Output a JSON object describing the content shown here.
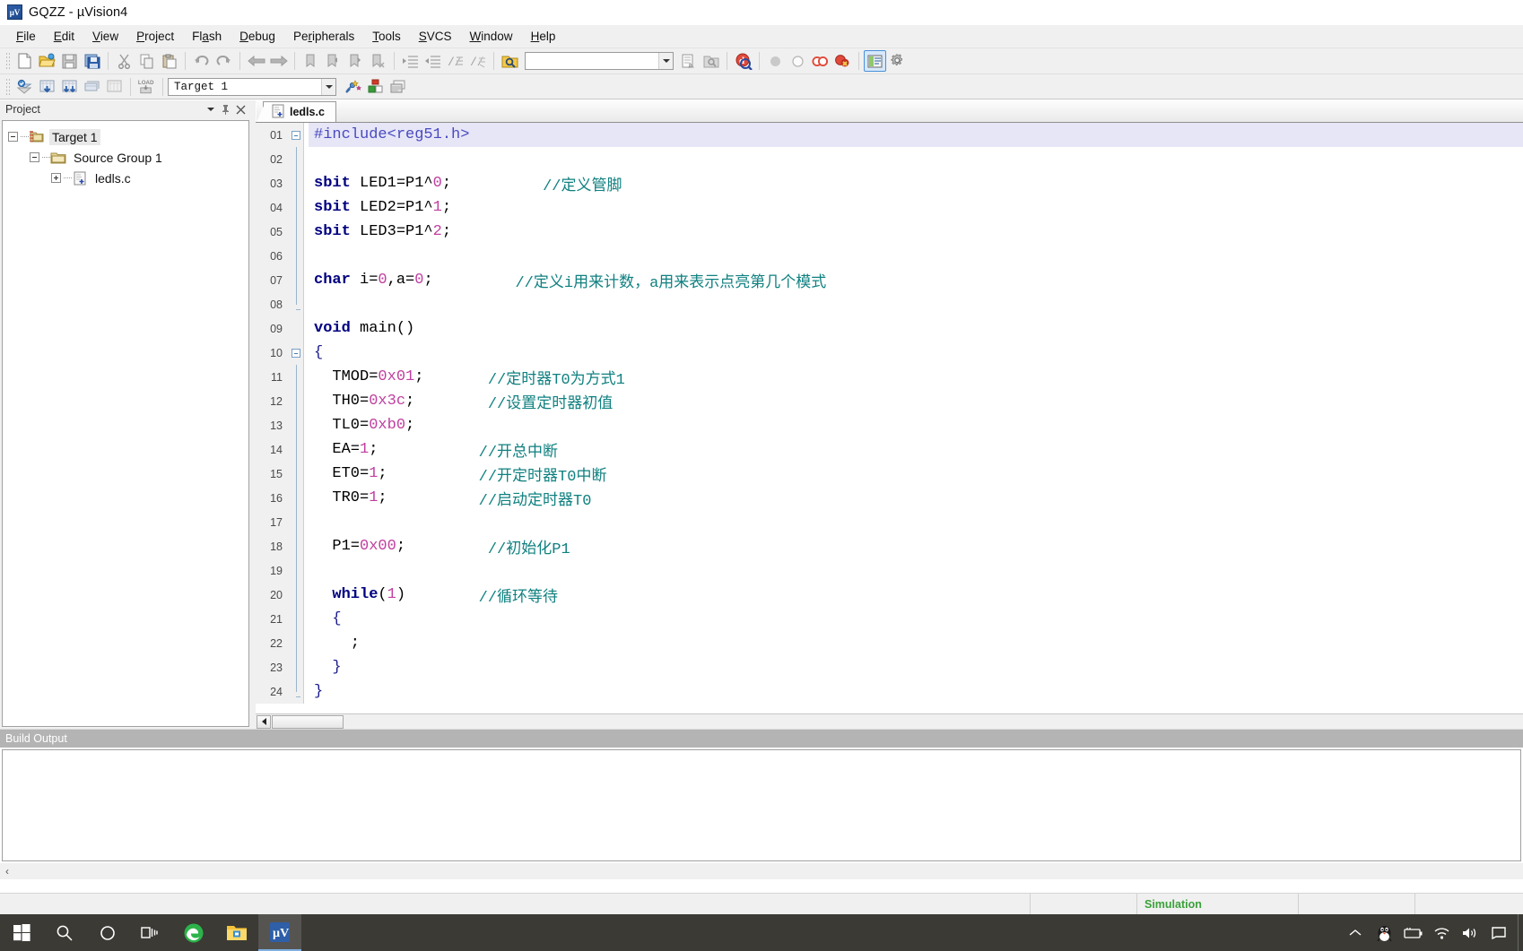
{
  "window": {
    "title": "GQZZ  -  µVision4",
    "app_icon": "uvision-logo-icon"
  },
  "menubar": {
    "items": [
      {
        "label": "File",
        "mnemonic": "F"
      },
      {
        "label": "Edit",
        "mnemonic": "E"
      },
      {
        "label": "View",
        "mnemonic": "V"
      },
      {
        "label": "Project",
        "mnemonic": "P"
      },
      {
        "label": "Flash",
        "mnemonic": "a"
      },
      {
        "label": "Debug",
        "mnemonic": "D"
      },
      {
        "label": "Peripherals",
        "mnemonic": "r"
      },
      {
        "label": "Tools",
        "mnemonic": "T"
      },
      {
        "label": "SVCS",
        "mnemonic": "S"
      },
      {
        "label": "Window",
        "mnemonic": "W"
      },
      {
        "label": "Help",
        "mnemonic": "H"
      }
    ]
  },
  "toolbar_main": {
    "buttons": [
      {
        "name": "new-file-icon",
        "tip": "New"
      },
      {
        "name": "open-file-icon",
        "tip": "Open"
      },
      {
        "name": "save-icon",
        "tip": "Save"
      },
      {
        "name": "save-all-icon",
        "tip": "Save All"
      },
      {
        "name": "cut-icon",
        "tip": "Cut"
      },
      {
        "name": "copy-icon",
        "tip": "Copy"
      },
      {
        "name": "paste-icon",
        "tip": "Paste"
      },
      {
        "name": "undo-icon",
        "tip": "Undo"
      },
      {
        "name": "redo-icon",
        "tip": "Redo"
      },
      {
        "name": "navigate-back-icon",
        "tip": "Back"
      },
      {
        "name": "navigate-forward-icon",
        "tip": "Forward"
      },
      {
        "name": "bookmark-toggle-icon",
        "tip": "Insert/Remove Bookmark"
      },
      {
        "name": "bookmark-prev-icon",
        "tip": "Previous Bookmark"
      },
      {
        "name": "bookmark-next-icon",
        "tip": "Next Bookmark"
      },
      {
        "name": "bookmark-clear-icon",
        "tip": "Clear All Bookmarks"
      },
      {
        "name": "indent-increase-icon",
        "tip": "Indent"
      },
      {
        "name": "indent-decrease-icon",
        "tip": "Outdent"
      },
      {
        "name": "comment-icon",
        "tip": "Comment"
      },
      {
        "name": "uncomment-icon",
        "tip": "Uncomment"
      },
      {
        "name": "find-in-files-icon",
        "tip": "Find in Files"
      }
    ],
    "search_value": "",
    "search_placeholder": "",
    "right_buttons": [
      {
        "name": "bookmark-list-icon",
        "tip": "Bookmarks"
      },
      {
        "name": "find-next-icon",
        "tip": "Find Next"
      },
      {
        "name": "start-debug-icon",
        "tip": "Start/Stop Debug Session"
      },
      {
        "name": "breakpoint-filled-icon",
        "tip": "Insert/Remove Breakpoint"
      },
      {
        "name": "breakpoint-empty-icon",
        "tip": "Enable/Disable Breakpoint"
      },
      {
        "name": "breakpoints-disable-all-icon",
        "tip": "Disable All Breakpoints"
      },
      {
        "name": "breakpoints-kill-all-icon",
        "tip": "Kill All Breakpoints"
      },
      {
        "name": "project-window-icon",
        "tip": "Project Window",
        "active": true
      },
      {
        "name": "configure-icon",
        "tip": "Configuration Wizard"
      }
    ]
  },
  "toolbar_build": {
    "buttons": [
      {
        "name": "translate-icon",
        "tip": "Translate"
      },
      {
        "name": "build-target-icon",
        "tip": "Build Target"
      },
      {
        "name": "rebuild-all-icon",
        "tip": "Rebuild All Target Files"
      },
      {
        "name": "batch-build-icon",
        "tip": "Batch Build"
      },
      {
        "name": "stop-build-icon",
        "tip": "Stop Build"
      },
      {
        "name": "download-icon",
        "tip": "Download"
      }
    ],
    "target_value": "Target 1",
    "after_buttons": [
      {
        "name": "target-options-icon",
        "tip": "Options for Target"
      },
      {
        "name": "manage-components-icon",
        "tip": "Manage Components"
      },
      {
        "name": "multi-project-icon",
        "tip": "Manage Multi-Project"
      }
    ]
  },
  "project_panel": {
    "title": "Project",
    "controls": [
      {
        "name": "panel-menu-icon",
        "glyph": "▼"
      },
      {
        "name": "panel-pin-icon",
        "glyph": "⚑"
      },
      {
        "name": "panel-close-icon",
        "glyph": "✕"
      }
    ],
    "tree": [
      {
        "label": "Target 1",
        "level": 1,
        "icon": "target-icon",
        "expander": "minus",
        "selected": true
      },
      {
        "label": "Source Group 1",
        "level": 2,
        "icon": "folder-icon",
        "expander": "minus",
        "selected": false
      },
      {
        "label": "ledls.c",
        "level": 3,
        "icon": "c-source-file-icon",
        "expander": "plus",
        "selected": false
      }
    ]
  },
  "editor": {
    "tabs": [
      {
        "label": "ledls.c",
        "icon": "c-source-file-icon",
        "active": true
      }
    ],
    "lines": [
      {
        "no": "01",
        "fold": "start",
        "hl": true,
        "tokens": [
          {
            "t": "#include<reg51.h>",
            "c": "pre"
          }
        ]
      },
      {
        "no": "02",
        "fold": "bar",
        "tokens": []
      },
      {
        "no": "03",
        "fold": "bar",
        "tokens": [
          {
            "t": "sbit",
            "c": "kw"
          },
          {
            "t": " LED1=P1^",
            "c": "plain"
          },
          {
            "t": "0",
            "c": "num"
          },
          {
            "t": ";",
            "c": "plain"
          },
          {
            "t": "          ",
            "c": "plain"
          },
          {
            "t": "//定义管脚",
            "c": "cmt"
          }
        ]
      },
      {
        "no": "04",
        "fold": "bar",
        "tokens": [
          {
            "t": "sbit",
            "c": "kw"
          },
          {
            "t": " LED2=P1^",
            "c": "plain"
          },
          {
            "t": "1",
            "c": "num"
          },
          {
            "t": ";",
            "c": "plain"
          }
        ]
      },
      {
        "no": "05",
        "fold": "bar",
        "tokens": [
          {
            "t": "sbit",
            "c": "kw"
          },
          {
            "t": " LED3=P1^",
            "c": "plain"
          },
          {
            "t": "2",
            "c": "num"
          },
          {
            "t": ";",
            "c": "plain"
          }
        ]
      },
      {
        "no": "06",
        "fold": "bar",
        "tokens": []
      },
      {
        "no": "07",
        "fold": "bar",
        "tokens": [
          {
            "t": "char",
            "c": "kw"
          },
          {
            "t": " i=",
            "c": "plain"
          },
          {
            "t": "0",
            "c": "num"
          },
          {
            "t": ",a=",
            "c": "plain"
          },
          {
            "t": "0",
            "c": "num"
          },
          {
            "t": ";",
            "c": "plain"
          },
          {
            "t": "         ",
            "c": "plain"
          },
          {
            "t": "//定义i用来计数，a用来表示点亮第几个模式",
            "c": "cmt"
          }
        ]
      },
      {
        "no": "08",
        "fold": "end",
        "tokens": []
      },
      {
        "no": "09",
        "fold": "none",
        "tokens": [
          {
            "t": "void",
            "c": "kw"
          },
          {
            "t": " main()",
            "c": "plain"
          }
        ]
      },
      {
        "no": "10",
        "fold": "start",
        "tokens": [
          {
            "t": "{",
            "c": "brace"
          }
        ]
      },
      {
        "no": "11",
        "fold": "bar",
        "tokens": [
          {
            "t": "  TMOD=",
            "c": "plain"
          },
          {
            "t": "0x01",
            "c": "num"
          },
          {
            "t": ";",
            "c": "plain"
          },
          {
            "t": "       ",
            "c": "plain"
          },
          {
            "t": "//定时器T0为方式1",
            "c": "cmt"
          }
        ]
      },
      {
        "no": "12",
        "fold": "bar",
        "tokens": [
          {
            "t": "  TH0=",
            "c": "plain"
          },
          {
            "t": "0x3c",
            "c": "num"
          },
          {
            "t": ";",
            "c": "plain"
          },
          {
            "t": "        ",
            "c": "plain"
          },
          {
            "t": "//设置定时器初值",
            "c": "cmt"
          }
        ]
      },
      {
        "no": "13",
        "fold": "bar",
        "tokens": [
          {
            "t": "  TL0=",
            "c": "plain"
          },
          {
            "t": "0xb0",
            "c": "num"
          },
          {
            "t": ";",
            "c": "plain"
          }
        ]
      },
      {
        "no": "14",
        "fold": "bar",
        "tokens": [
          {
            "t": "  EA=",
            "c": "plain"
          },
          {
            "t": "1",
            "c": "num"
          },
          {
            "t": ";",
            "c": "plain"
          },
          {
            "t": "           ",
            "c": "plain"
          },
          {
            "t": "//开总中断",
            "c": "cmt"
          }
        ]
      },
      {
        "no": "15",
        "fold": "bar",
        "tokens": [
          {
            "t": "  ET0=",
            "c": "plain"
          },
          {
            "t": "1",
            "c": "num"
          },
          {
            "t": ";",
            "c": "plain"
          },
          {
            "t": "          ",
            "c": "plain"
          },
          {
            "t": "//开定时器T0中断",
            "c": "cmt"
          }
        ]
      },
      {
        "no": "16",
        "fold": "bar",
        "tokens": [
          {
            "t": "  TR0=",
            "c": "plain"
          },
          {
            "t": "1",
            "c": "num"
          },
          {
            "t": ";",
            "c": "plain"
          },
          {
            "t": "          ",
            "c": "plain"
          },
          {
            "t": "//启动定时器T0",
            "c": "cmt"
          }
        ]
      },
      {
        "no": "17",
        "fold": "bar",
        "tokens": []
      },
      {
        "no": "18",
        "fold": "bar",
        "tokens": [
          {
            "t": "  P1=",
            "c": "plain"
          },
          {
            "t": "0x00",
            "c": "num"
          },
          {
            "t": ";",
            "c": "plain"
          },
          {
            "t": "         ",
            "c": "plain"
          },
          {
            "t": "//初始化P1",
            "c": "cmt"
          }
        ]
      },
      {
        "no": "19",
        "fold": "bar",
        "tokens": []
      },
      {
        "no": "20",
        "fold": "bar",
        "tokens": [
          {
            "t": "  ",
            "c": "plain"
          },
          {
            "t": "while",
            "c": "kw"
          },
          {
            "t": "(",
            "c": "plain"
          },
          {
            "t": "1",
            "c": "num"
          },
          {
            "t": ")",
            "c": "plain"
          },
          {
            "t": "        ",
            "c": "plain"
          },
          {
            "t": "//循环等待",
            "c": "cmt"
          }
        ]
      },
      {
        "no": "21",
        "fold": "bar",
        "tokens": [
          {
            "t": "  ",
            "c": "plain"
          },
          {
            "t": "{",
            "c": "brace"
          }
        ]
      },
      {
        "no": "22",
        "fold": "bar",
        "tokens": [
          {
            "t": "    ;",
            "c": "plain"
          }
        ]
      },
      {
        "no": "23",
        "fold": "bar",
        "tokens": [
          {
            "t": "  ",
            "c": "plain"
          },
          {
            "t": "}",
            "c": "brace"
          }
        ]
      },
      {
        "no": "24",
        "fold": "end",
        "tokens": [
          {
            "t": "}",
            "c": "brace"
          }
        ]
      }
    ]
  },
  "build_output": {
    "title": "Build Output",
    "content": "",
    "footer_glyph": "‹"
  },
  "statusbar": {
    "left_text": "",
    "simulation_label": "Simulation"
  },
  "taskbar": {
    "start": {
      "name": "windows-start-icon"
    },
    "items": [
      {
        "name": "taskbar-search-icon"
      },
      {
        "name": "taskbar-cortana-icon"
      },
      {
        "name": "taskbar-taskview-icon"
      },
      {
        "name": "taskbar-edge-icon"
      },
      {
        "name": "taskbar-file-explorer-icon"
      },
      {
        "name": "taskbar-uvision-icon",
        "active": true
      }
    ],
    "tray": [
      {
        "name": "tray-chevron-up-icon"
      },
      {
        "name": "tray-qq-icon"
      },
      {
        "name": "tray-battery-icon"
      },
      {
        "name": "tray-network-icon"
      },
      {
        "name": "tray-volume-icon"
      },
      {
        "name": "tray-action-center-icon"
      }
    ]
  },
  "colors": {
    "keyword": "#000080",
    "preprocessor": "#4a4ac0",
    "number": "#c040a0",
    "comment": "#108080",
    "highlight_line": "#e6e6f7",
    "simulation_green": "#3aa13a",
    "taskbar": "#3b3a35"
  }
}
